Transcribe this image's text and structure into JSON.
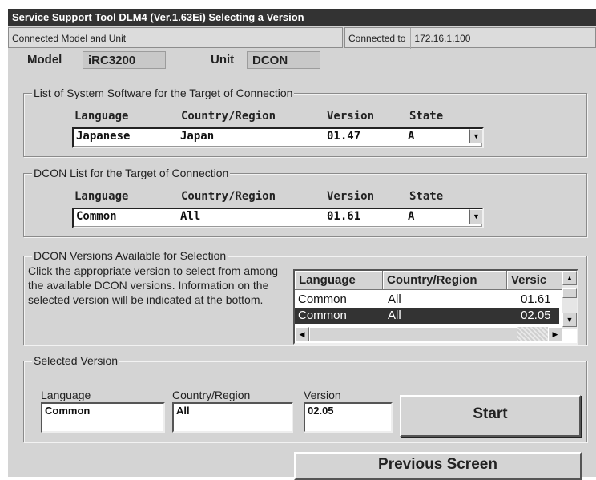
{
  "window": {
    "title": "Service Support Tool DLM4 (Ver.1.63Ei) Selecting a Version"
  },
  "connection": {
    "label": "Connected Model and Unit",
    "connected_to_label": "Connected to",
    "ip": "172.16.1.100",
    "model_label": "Model",
    "model_value": "iRC3200",
    "unit_label": "Unit",
    "unit_value": "DCON"
  },
  "system_software": {
    "title": "List of System Software for the Target of Connection",
    "headers": {
      "language": "Language",
      "country": "Country/Region",
      "version": "Version",
      "state": "State"
    },
    "selected": {
      "language": "Japanese",
      "country": "Japan",
      "version": "01.47",
      "state": "A"
    }
  },
  "dcon_list": {
    "title": "DCON List for the Target of Connection",
    "headers": {
      "language": "Language",
      "country": "Country/Region",
      "version": "Version",
      "state": "State"
    },
    "selected": {
      "language": "Common",
      "country": "All",
      "version": "01.61",
      "state": "A"
    }
  },
  "available": {
    "title": "DCON Versions Available for Selection",
    "description": "Click the appropriate version to select from among the available DCON versions. Information on the selected version will be indicated at the bottom.",
    "columns": [
      "Language",
      "Country/Region",
      "Versic"
    ],
    "rows": [
      {
        "language": "Common",
        "country": "All",
        "version": "01.61"
      },
      {
        "language": "Common",
        "country": "All",
        "version": "02.05"
      }
    ],
    "selected_row": 1
  },
  "selected_version": {
    "title": "Selected Version",
    "language_label": "Language",
    "language_value": "Common",
    "country_label": "Country/Region",
    "country_value": "All",
    "version_label": "Version",
    "version_value": "02.05"
  },
  "buttons": {
    "start": "Start",
    "previous": "Previous Screen"
  },
  "icons": {
    "dropdown": "chevron-down-icon",
    "scroll_up": "arrow-up-icon",
    "scroll_down": "arrow-down-icon",
    "scroll_left": "arrow-left-icon",
    "scroll_right": "arrow-right-icon"
  }
}
